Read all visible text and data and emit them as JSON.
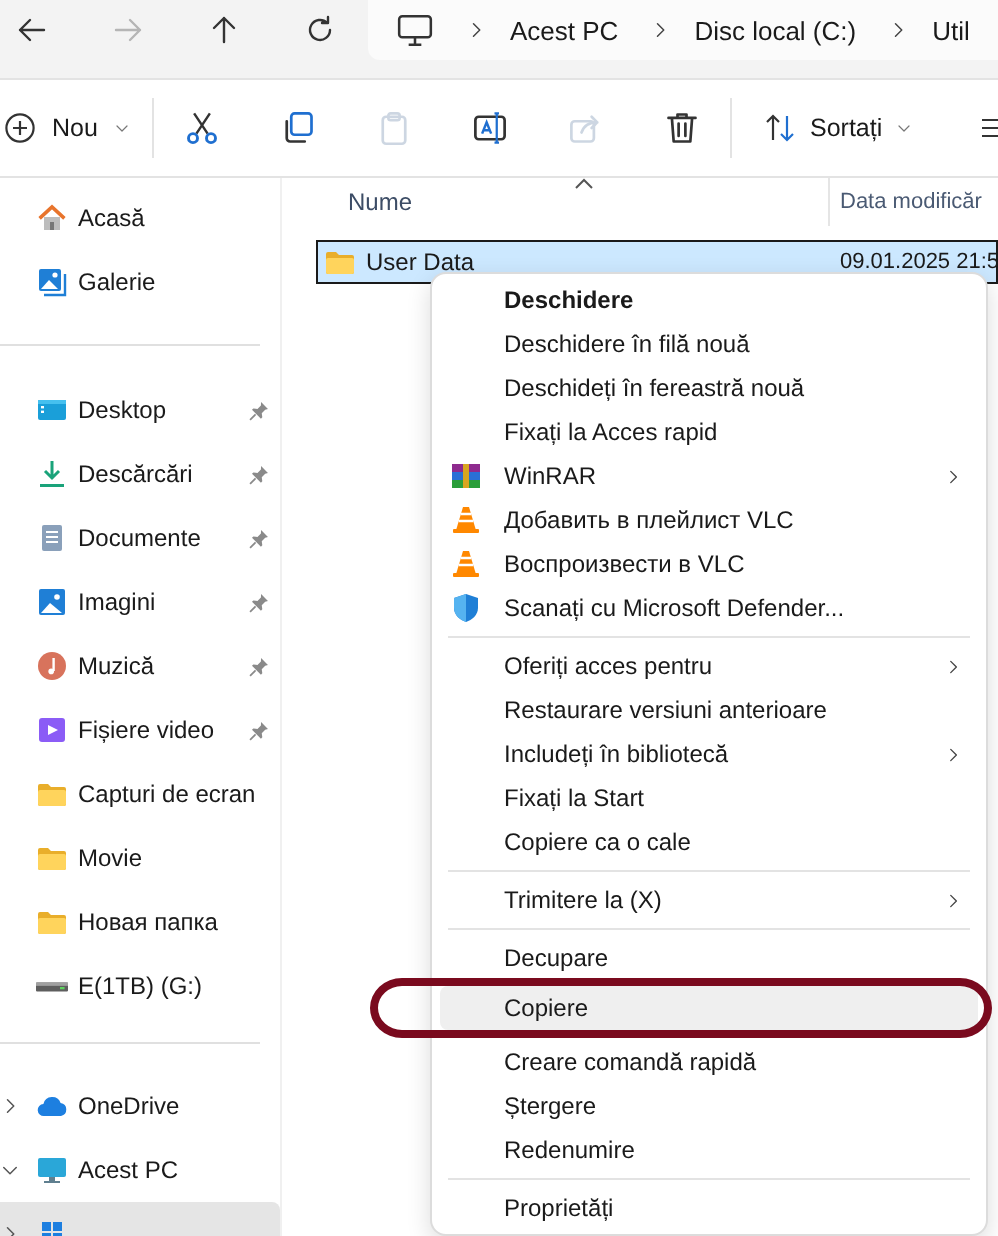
{
  "nav_buttons": [
    {
      "kind": "back",
      "disabled": false
    },
    {
      "kind": "forward",
      "disabled": true
    },
    {
      "kind": "up",
      "disabled": false
    },
    {
      "kind": "refresh",
      "disabled": false
    }
  ],
  "breadcrumb": [
    "Acest PC",
    "Disc local (C:)",
    "Util"
  ],
  "toolbar": {
    "new_label": "Nou",
    "actions": [
      {
        "kind": "cut",
        "disabled": false
      },
      {
        "kind": "copy",
        "disabled": false
      },
      {
        "kind": "paste",
        "disabled": true
      },
      {
        "kind": "rename",
        "disabled": false
      },
      {
        "kind": "share",
        "disabled": true
      },
      {
        "kind": "delete",
        "disabled": false
      }
    ],
    "sort_label": "Sortați"
  },
  "sidebar": {
    "top": [
      {
        "label": "Acasă",
        "kind": "home"
      },
      {
        "label": "Galerie",
        "kind": "gallery"
      }
    ],
    "quick_access": [
      {
        "label": "Desktop",
        "kind": "desktop",
        "pinned": true
      },
      {
        "label": "Descărcări",
        "kind": "download",
        "pinned": true
      },
      {
        "label": "Documente",
        "kind": "documents",
        "pinned": true
      },
      {
        "label": "Imagini",
        "kind": "pictures",
        "pinned": true
      },
      {
        "label": "Muzică",
        "kind": "music",
        "pinned": true
      },
      {
        "label": "Fișiere video",
        "kind": "video",
        "pinned": true
      },
      {
        "label": "Capturi de ecran",
        "kind": "folder",
        "pinned": false
      },
      {
        "label": "Movie",
        "kind": "folder",
        "pinned": false
      },
      {
        "label": "Новая папка",
        "kind": "folder",
        "pinned": false
      },
      {
        "label": "E(1TB) (G:)",
        "kind": "drive",
        "pinned": false
      }
    ],
    "tree": [
      {
        "label": "OneDrive",
        "kind": "cloud",
        "expanded": false,
        "selected": false
      },
      {
        "label": "Acest PC",
        "kind": "pc",
        "expanded": true,
        "selected": false
      },
      {
        "kind": "windows-drive",
        "expanded": false,
        "selected": true
      }
    ]
  },
  "columns": [
    {
      "label": "Nume",
      "sorted": true
    },
    {
      "label": "Data modificăr",
      "sorted": false
    }
  ],
  "files": [
    {
      "name": "User Data",
      "date": "09.01.2025 21:5",
      "selected": true
    }
  ],
  "context_menu": {
    "items": [
      {
        "kind": "plain",
        "label": "Deschidere",
        "bold": true,
        "submenu": false,
        "highlighted": false,
        "circled": false
      },
      {
        "kind": "plain",
        "label": "Deschidere în filă nouă",
        "bold": false,
        "submenu": false,
        "highlighted": false,
        "circled": false
      },
      {
        "kind": "plain",
        "label": "Deschideți în fereastră nouă",
        "bold": false,
        "submenu": false,
        "highlighted": false,
        "circled": false
      },
      {
        "kind": "plain",
        "label": "Fixați la Acces rapid",
        "bold": false,
        "submenu": false,
        "highlighted": false,
        "circled": false
      },
      {
        "kind": "winrar",
        "label": "WinRAR",
        "bold": false,
        "submenu": true,
        "highlighted": false,
        "circled": false
      },
      {
        "kind": "vlc",
        "label": "Добавить в плейлист VLC",
        "bold": false,
        "submenu": false,
        "highlighted": false,
        "circled": false
      },
      {
        "kind": "vlc",
        "label": "Воспроизвести в VLC",
        "bold": false,
        "submenu": false,
        "highlighted": false,
        "circled": false
      },
      {
        "kind": "defender",
        "label": "Scanați cu Microsoft Defender...",
        "bold": false,
        "submenu": false,
        "highlighted": false,
        "circled": false
      },
      {
        "kind": "separator"
      },
      {
        "kind": "plain",
        "label": "Oferiți acces pentru",
        "bold": false,
        "submenu": true,
        "highlighted": false,
        "circled": false
      },
      {
        "kind": "plain",
        "label": "Restaurare versiuni anterioare",
        "bold": false,
        "submenu": false,
        "highlighted": false,
        "circled": false
      },
      {
        "kind": "plain",
        "label": "Includeți în bibliotecă",
        "bold": false,
        "submenu": true,
        "highlighted": false,
        "circled": false
      },
      {
        "kind": "plain",
        "label": "Fixați la Start",
        "bold": false,
        "submenu": false,
        "highlighted": false,
        "circled": false
      },
      {
        "kind": "plain",
        "label": "Copiere ca o cale",
        "bold": false,
        "submenu": false,
        "highlighted": false,
        "circled": false
      },
      {
        "kind": "separator"
      },
      {
        "kind": "plain",
        "label": "Trimitere la (X)",
        "bold": false,
        "submenu": true,
        "highlighted": false,
        "circled": false
      },
      {
        "kind": "separator"
      },
      {
        "kind": "plain",
        "label": "Decupare",
        "bold": false,
        "submenu": false,
        "highlighted": false,
        "circled": false
      },
      {
        "kind": "plain",
        "label": "Copiere",
        "bold": false,
        "submenu": false,
        "highlighted": true,
        "circled": true
      },
      {
        "kind": "plain",
        "label": "Creare comandă rapidă",
        "bold": false,
        "submenu": false,
        "highlighted": false,
        "circled": false
      },
      {
        "kind": "plain",
        "label": "Ștergere",
        "bold": false,
        "submenu": false,
        "highlighted": false,
        "circled": false
      },
      {
        "kind": "plain",
        "label": "Redenumire",
        "bold": false,
        "submenu": false,
        "highlighted": false,
        "circled": false
      },
      {
        "kind": "separator"
      },
      {
        "kind": "plain",
        "label": "Proprietăți",
        "bold": false,
        "submenu": false,
        "highlighted": false,
        "circled": false
      }
    ]
  }
}
